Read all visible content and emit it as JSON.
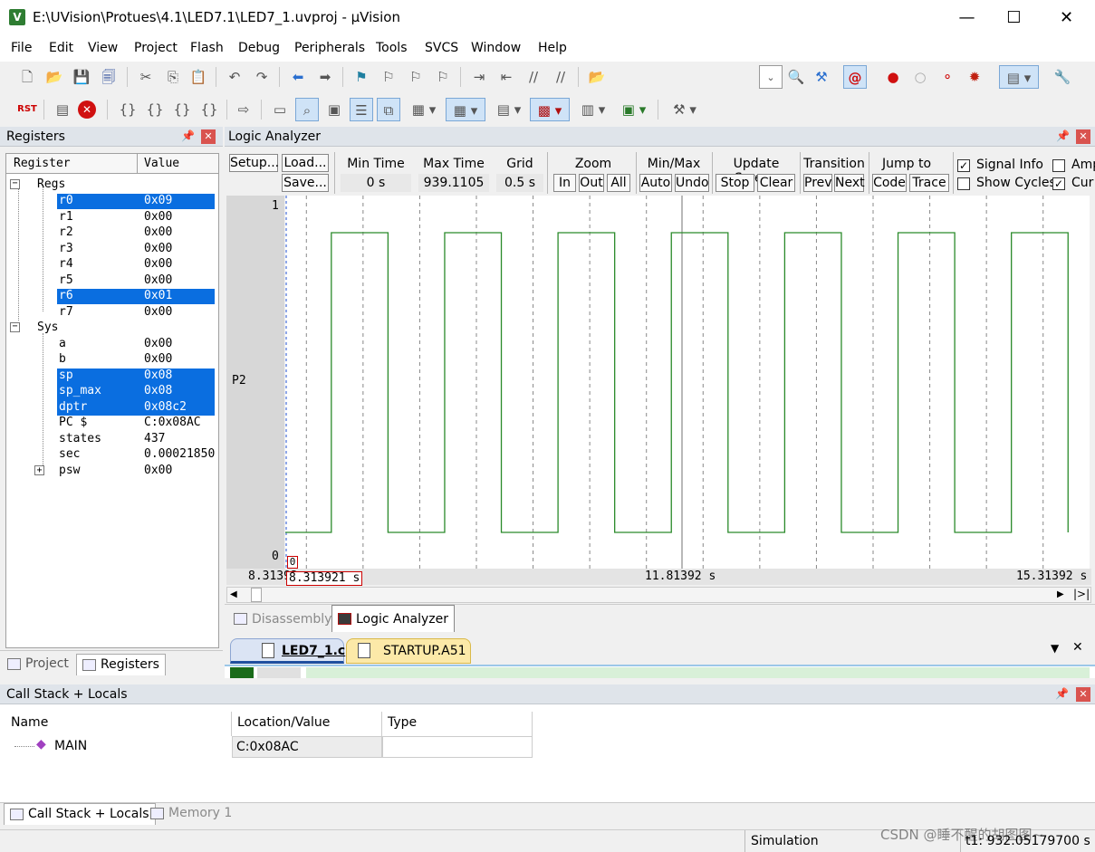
{
  "window": {
    "title": "E:\\UVision\\Protues\\4.1\\LED7.1\\LED7_1.uvproj - µVision",
    "minimize": "—",
    "maximize": "☐",
    "close": "✕"
  },
  "menu": [
    "File",
    "Edit",
    "View",
    "Project",
    "Flash",
    "Debug",
    "Peripherals",
    "Tools",
    "SVCS",
    "Window",
    "Help"
  ],
  "registers": {
    "title": "Registers",
    "col_register": "Register",
    "col_value": "Value",
    "groups": [
      {
        "name": "Regs",
        "rows": [
          {
            "name": "r0",
            "value": "0x09",
            "selected": true
          },
          {
            "name": "r1",
            "value": "0x00",
            "selected": false
          },
          {
            "name": "r2",
            "value": "0x00",
            "selected": false
          },
          {
            "name": "r3",
            "value": "0x00",
            "selected": false
          },
          {
            "name": "r4",
            "value": "0x00",
            "selected": false
          },
          {
            "name": "r5",
            "value": "0x00",
            "selected": false
          },
          {
            "name": "r6",
            "value": "0x01",
            "selected": true
          },
          {
            "name": "r7",
            "value": "0x00",
            "selected": false
          }
        ]
      },
      {
        "name": "Sys",
        "rows": [
          {
            "name": "a",
            "value": "0x00",
            "selected": false
          },
          {
            "name": "b",
            "value": "0x00",
            "selected": false
          },
          {
            "name": "sp",
            "value": "0x08",
            "selected": true
          },
          {
            "name": "sp_max",
            "value": "0x08",
            "selected": true
          },
          {
            "name": "dptr",
            "value": "0x08c2",
            "selected": true
          },
          {
            "name": "PC  $",
            "value": "C:0x08AC",
            "selected": false
          },
          {
            "name": "states",
            "value": "437",
            "selected": false
          },
          {
            "name": "sec",
            "value": "0.00021850",
            "selected": false
          },
          {
            "name": "psw",
            "value": "0x00",
            "selected": false
          }
        ]
      }
    ],
    "tab_project": "Project",
    "tab_registers": "Registers"
  },
  "logic_analyzer": {
    "title": "Logic Analyzer",
    "setup": "Setup...",
    "load": "Load...",
    "save": "Save...",
    "min_time_label": "Min Time",
    "min_time": "0 s",
    "max_time_label": "Max Time",
    "max_time": "939.1105 s",
    "grid_label": "Grid",
    "grid": "0.5 s",
    "zoom_label": "Zoom",
    "zoom_in": "In",
    "zoom_out": "Out",
    "zoom_all": "All",
    "minmax_label": "Min/Max",
    "auto": "Auto",
    "undo": "Undo",
    "update_label": "Update Screen",
    "stop": "Stop",
    "clear": "Clear",
    "transition_label": "Transition",
    "prev": "Prev",
    "next": "Next",
    "jump_label": "Jump to",
    "code": "Code",
    "trace": "Trace",
    "signal_info": "Signal Info",
    "show_cycles": "Show Cycles",
    "amp": "Amp",
    "cur": "Cur",
    "signal_name": "P2",
    "y_high": "1",
    "y_low": "0",
    "t_left": "8.31392 s",
    "t_mid": "11.81392 s",
    "t_right": "15.31392 s",
    "cursor_label": "8.313921  s",
    "cursor_marker": "0",
    "waveform": {
      "t_start": 8.31392,
      "t_end": 15.5,
      "period": 1.0,
      "high_start": 8.72,
      "high_duration": 0.5
    }
  },
  "doc_tabs": {
    "disassembly": "Disassembly",
    "logic_analyzer": "Logic Analyzer"
  },
  "editor_tabs": [
    "LED7_1.c",
    "STARTUP.A51"
  ],
  "callstack": {
    "title": "Call Stack + Locals",
    "headers": [
      "Name",
      "Location/Value",
      "Type"
    ],
    "rows": [
      {
        "name": "MAIN",
        "location": "C:0x08AC",
        "type": ""
      }
    ],
    "tab_callstack": "Call Stack + Locals",
    "tab_memory": "Memory 1"
  },
  "status": {
    "mode": "Simulation",
    "time": "t1: 932.05179700 s",
    "watermark": "CSDN @睡不醒的胡图图~"
  },
  "colors": {
    "signal": "#2a8a2a",
    "selection": "#0a6ee0",
    "panel_head": "#dfe4ea"
  }
}
